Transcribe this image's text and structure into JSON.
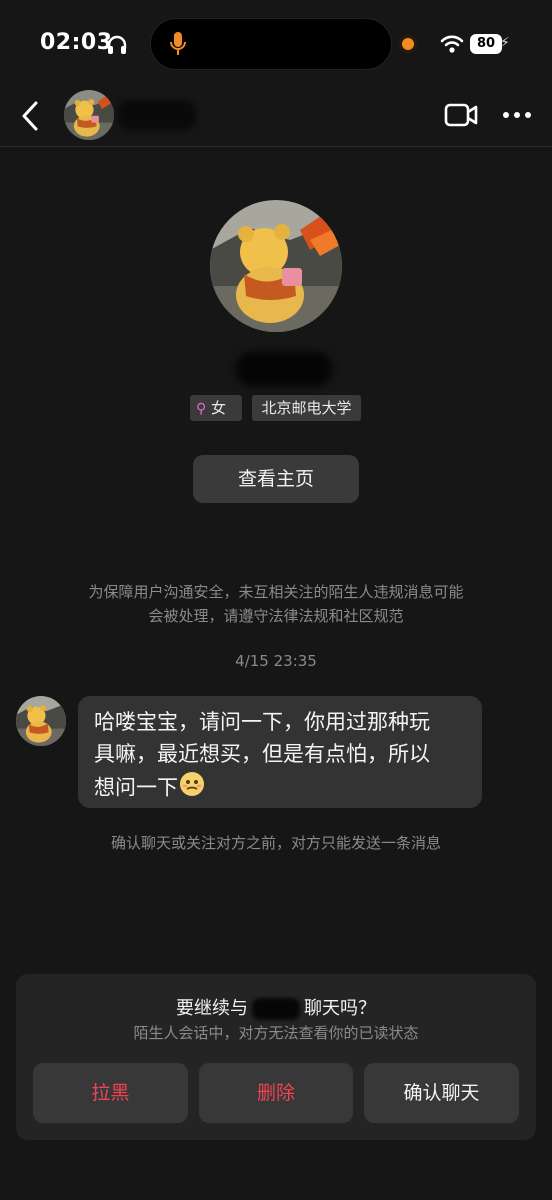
{
  "status_bar": {
    "time": "02:03",
    "battery": "80"
  },
  "profile": {
    "tags": {
      "gender": "女",
      "school": "北京邮电大学"
    },
    "homepage_button": "查看主页"
  },
  "chat": {
    "notice_line1": "为保障用户沟通安全，未互相关注的陌生人违规消息可能",
    "notice_line2": "会被处理，请遵守法律法规和社区规范",
    "timestamp": "4/15 23:35",
    "message_line1": "哈喽宝宝，请问一下，你用过那种玩",
    "message_line2": "具嘛，最近想买，但是有点怕，所以",
    "message_line3": "想问一下",
    "limit_note": "确认聊天或关注对方之前，对方只能发送一条消息"
  },
  "prompt_card": {
    "title_before": "要继续与",
    "title_after": "聊天吗？",
    "subtitle": "陌生人会话中，对方无法查看你的已读状态",
    "block_label": "拉黑",
    "delete_label": "删除",
    "confirm_label": "确认聊天"
  },
  "colors": {
    "background": "#161616",
    "danger": "#f04452",
    "card": "#242424",
    "button": "#383838"
  },
  "icons": [
    "headphone-icon",
    "microphone-icon",
    "wifi-icon",
    "battery-icon",
    "back-arrow-icon",
    "video-call-icon",
    "more-icon",
    "female-icon",
    "emoji-icon"
  ]
}
